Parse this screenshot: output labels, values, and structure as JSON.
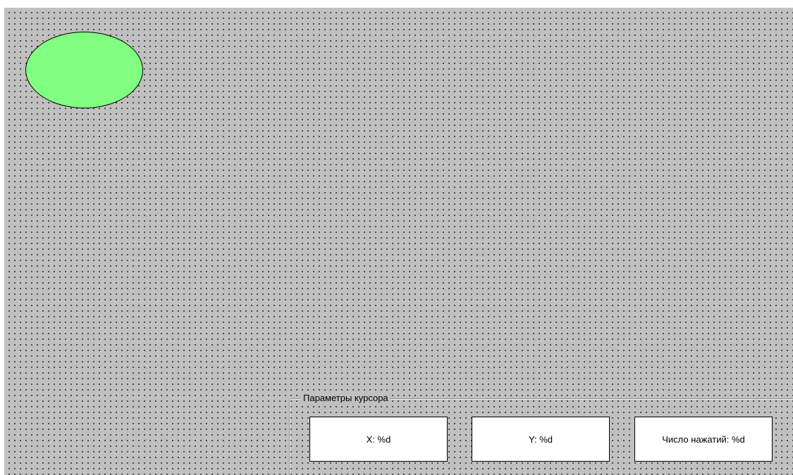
{
  "canvas": {
    "background": "#c0c0c0",
    "grid_dot_color": "#000000"
  },
  "shape": {
    "kind": "ellipse",
    "fill": "#80ff80",
    "stroke": "#000000"
  },
  "cursor_group": {
    "caption": "Параметры курсора",
    "x_label": "X: %d",
    "y_label": "Y: %d",
    "clicks_label": "Число нажатий: %d"
  }
}
